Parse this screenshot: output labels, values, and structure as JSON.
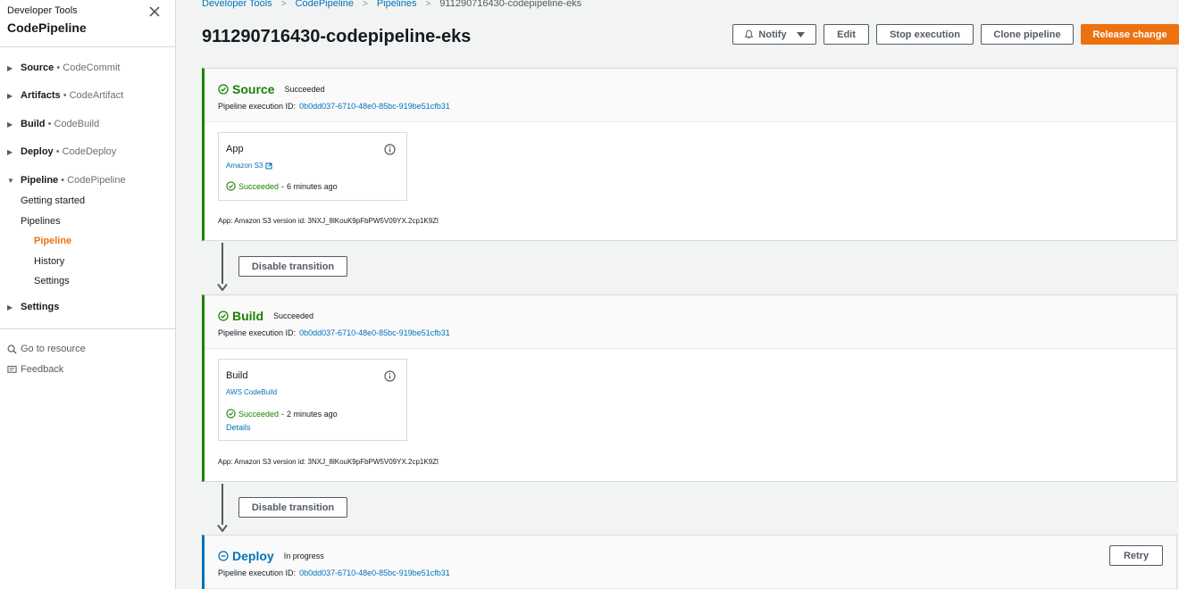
{
  "sidebar": {
    "service": "Developer Tools",
    "title": "CodePipeline",
    "groups": [
      {
        "name": "Source",
        "service": "CodeCommit"
      },
      {
        "name": "Artifacts",
        "service": "CodeArtifact"
      },
      {
        "name": "Build",
        "service": "CodeBuild"
      },
      {
        "name": "Deploy",
        "service": "CodeDeploy"
      },
      {
        "name": "Pipeline",
        "service": "CodePipeline"
      },
      {
        "name": "Settings",
        "service": ""
      }
    ],
    "pipeline_links": [
      "Getting started",
      "Pipelines"
    ],
    "pipeline_sublinks": [
      "Pipeline",
      "History",
      "Settings"
    ],
    "go_to_resource": "Go to resource",
    "feedback": "Feedback",
    "bullet": "•"
  },
  "breadcrumb": [
    "Developer Tools",
    "CodePipeline",
    "Pipelines",
    "911290716430-codepipeline-eks"
  ],
  "page_title": "911290716430-codepipeline-eks",
  "buttons": {
    "notify": "Notify",
    "edit": "Edit",
    "stop": "Stop execution",
    "clone": "Clone pipeline",
    "release": "Release change"
  },
  "exec_label": "Pipeline execution ID:",
  "exec_id": "0b0dd037-6710-48e0-85bc-919be51cfb31",
  "stages": [
    {
      "name": "Source",
      "status": "Succeeded",
      "action": {
        "name": "App",
        "provider": "Amazon S3",
        "status": "Succeeded",
        "ago": "6 minutes ago",
        "details": ""
      },
      "artifact": "App: Amazon S3 version id: 3NXJ_8lKouK9pFbPW5V09YX.2cp1K9Zl"
    },
    {
      "name": "Build",
      "status": "Succeeded",
      "action": {
        "name": "Build",
        "provider": "AWS CodeBuild",
        "status": "Succeeded",
        "ago": "2 minutes ago",
        "details": "Details"
      },
      "artifact": "App: Amazon S3 version id: 3NXJ_8lKouK9pFbPW5V09YX.2cp1K9Zl"
    },
    {
      "name": "Deploy",
      "status": "In progress",
      "retry": "Retry"
    }
  ],
  "transition_button": "Disable transition",
  "colors": {
    "success": "#1d8102",
    "in_progress": "#0073bb",
    "primary": "#ec7211",
    "link": "#0073bb"
  }
}
